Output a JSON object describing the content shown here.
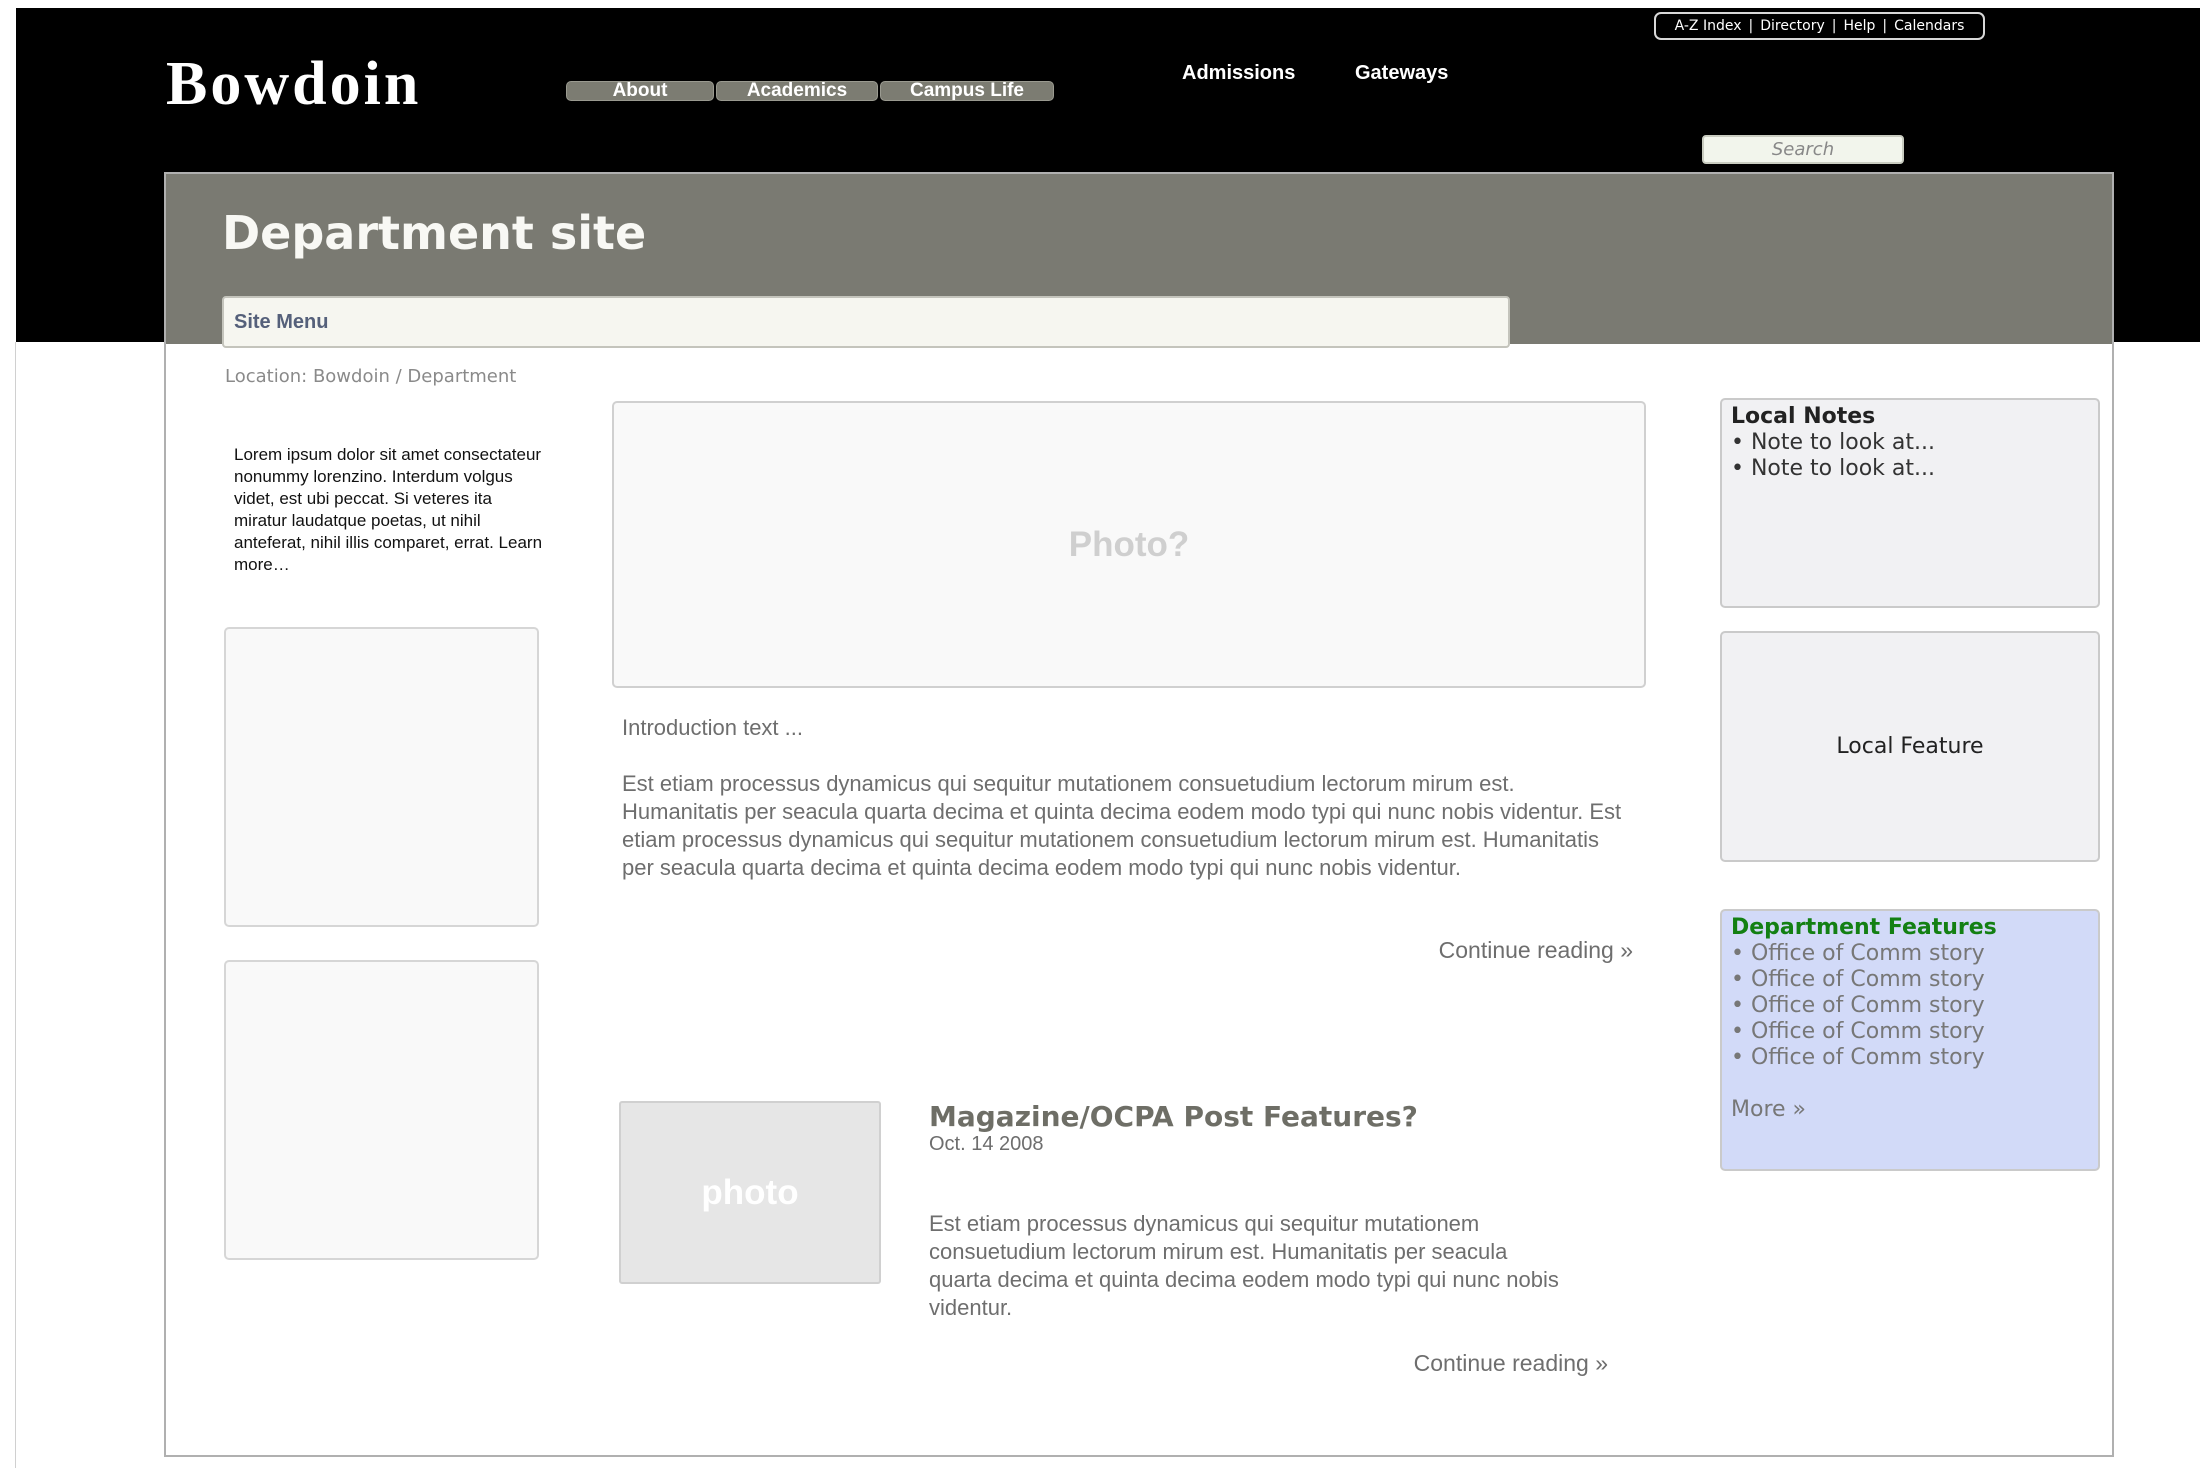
{
  "utility_links": [
    "A-Z Index",
    "Directory",
    "Help",
    "Calendars"
  ],
  "logo": "Bowdoin",
  "nav": {
    "about": "About",
    "academics": "Academics",
    "campus_life": "Campus Life",
    "admissions": "Admissions",
    "gateways": "Gateways"
  },
  "search": {
    "placeholder": "Search"
  },
  "department_title": "Department site",
  "site_menu": "Site Menu",
  "breadcrumb": {
    "prefix": "Location:",
    "items": [
      "Bowdoin",
      "Department"
    ],
    "separator": "/"
  },
  "sidebar_text": "Lorem ipsum dolor sit amet consectateur nonummy lorenzino. Interdum volgus videt, est ubi peccat. Si veteres ita miratur laudatque poetas, ut nihil anteferat, nihil illis comparet, errat. Learn more…",
  "main": {
    "photo_placeholder": "Photo?",
    "intro": "Introduction text ...",
    "body": "Est etiam processus dynamicus qui sequitur mutationem consuetudium lectorum mirum est. Humanitatis per seacula quarta decima et quinta decima eodem modo typi qui nunc nobis videntur. Est etiam processus dynamicus qui sequitur mutationem consuetudium lectorum mirum est. Humanitatis per seacula quarta decima et quinta decima eodem modo typi qui nunc nobis videntur.",
    "continue": "Continue reading »"
  },
  "feature_post": {
    "photo_label": "photo",
    "title": "Magazine/OCPA Post Features?",
    "date": "Oct. 14 2008",
    "body": "Est etiam processus dynamicus qui sequitur mutationem consuetudium lectorum mirum est. Humanitatis per seacula quarta decima et quinta decima eodem modo typi qui nunc nobis videntur.",
    "continue": "Continue reading »"
  },
  "local_notes": {
    "title": "Local Notes",
    "items": [
      "• Note to look at...",
      "• Note to look at..."
    ]
  },
  "local_feature": "Local Feature",
  "department_features": {
    "title": "Department Features",
    "items": [
      "• Office of Comm story",
      "• Office of Comm story",
      "• Office of Comm story",
      "• Office of Comm story",
      "• Office of Comm story"
    ],
    "more": "More »"
  }
}
